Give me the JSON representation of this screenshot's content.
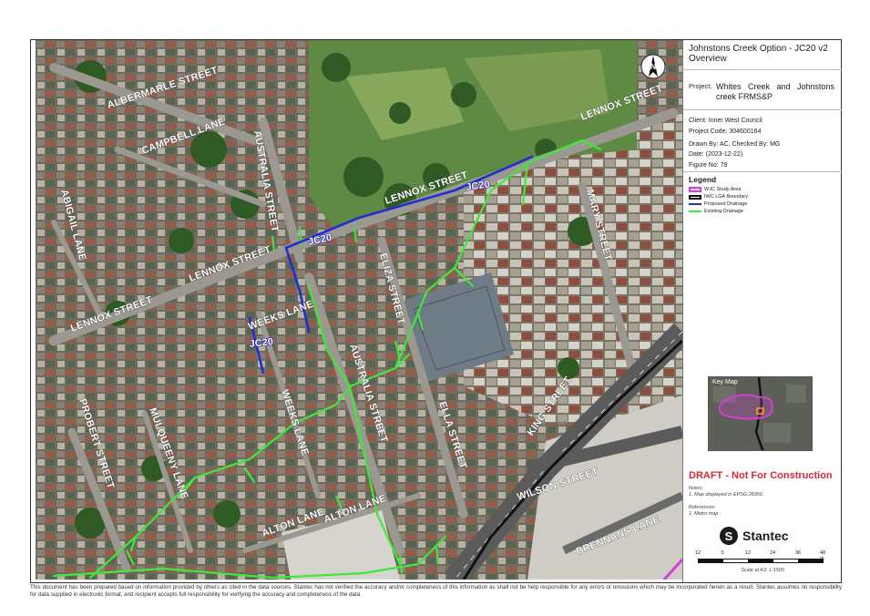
{
  "title_block": {
    "title": "Johnstons Creek Option - JC20 v2 Overview",
    "project_label": "Project:",
    "project_value": "Whites Creek and Johnstons creek FRMS&P",
    "client": "Client: Inner West Council",
    "project_code": "Project Code: 304600164",
    "drawn_by": "Drawn By: AC, Checked By: MG",
    "date": "Date: (2023-12-22)",
    "figure_no": "Figure No: 79"
  },
  "legend": {
    "title": "Legend",
    "items": [
      {
        "label": "WJC Study Area",
        "color": "#d33fd3"
      },
      {
        "label": "IWC LGA Boundary",
        "color": "#111111"
      },
      {
        "label": "Proposed Drainage",
        "color": "#1f2fd0"
      },
      {
        "label": "Existing Drainage",
        "color": "#3fe83a"
      }
    ]
  },
  "key_map": {
    "title": "Key Map"
  },
  "draft_notice": "DRAFT - Not For Construction",
  "notes": {
    "heading": "Notes:",
    "line1": "1. Map displayed in EPSG:28356",
    "ref_heading": "References:",
    "ref1": "1. Metro map"
  },
  "logo": {
    "mark": "S",
    "name": "Stantec"
  },
  "scale_bar": {
    "ticks": [
      "12",
      "0",
      "12",
      "24",
      "36",
      "48 m"
    ],
    "caption": "Scale at A3: 1:1500"
  },
  "north_arrow": {
    "letter": "N"
  },
  "map_labels": {
    "albermarle_street": "ALBERMARLE STREET",
    "campbell_lane": "CAMPBELL LANE",
    "australia_street_top": "AUSTRALIA STREET",
    "abigail_lane": "ABIGAIL LANE",
    "lennox_street_ne": "LENNOX STREET",
    "lennox_street_mid": "LENNOX STREET",
    "lennox_street_west": "LENNOX STREET",
    "lennox_street_far_west": "LENNOX STREET",
    "mary_street": "MARY STREET",
    "eliza_street": "ELIZA STREET",
    "weeks_lane_top": "WEEKS LANE",
    "weeks_lane_bottom": "WEEKS LANE",
    "australia_street_bottom": "AUSTRALIA STREET",
    "ella_street": "ELLA STREET",
    "king_street": "KING STREET",
    "probert_street": "PROBERT STREET",
    "mulqueeny_lane": "MULQUEENY LANE",
    "alton_lane_west": "ALTON LANE",
    "alton_lane_east": "ALTON LANE",
    "wilson_street": "WILSON STREET",
    "brennans_lane": "BRENNANS LANE",
    "jc20_top": "JC20",
    "jc20_mid": "JC20",
    "jc20_left": "JC20"
  },
  "disclaimer": "This document has been prepared based on information provided by others as cited in the data sources. Stantec has not verified the accuracy and/or completeness of this information as shall not be help responsible for any errors or omissions which may be incorporated herein as a result. Stantec assumes no responsibility for data supplied in electronic format, and recipient accepts full responsibility for verifying the accuracy and completeness of the data."
}
